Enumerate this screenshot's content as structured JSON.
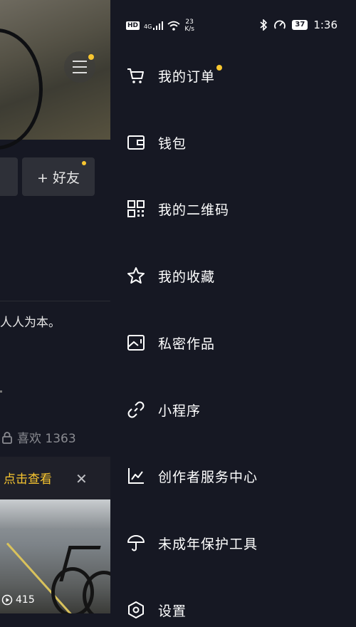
{
  "colors": {
    "background": "#161823",
    "accent_dot": "#f8c630",
    "notice_text": "#f8c630"
  },
  "status_bar": {
    "hd": "HD",
    "network": "4G",
    "speed_value": "23",
    "speed_unit": "K/s",
    "battery": "37",
    "time": "1:36",
    "icons": [
      "bluetooth-icon",
      "data-saver-icon"
    ]
  },
  "profile": {
    "add_friend_label": "+ 好友",
    "bio_fragment": "人人为本。",
    "likes_label": "喜欢 1363",
    "notice_text": "点击查看",
    "notice_close": "✕",
    "video_views": "415"
  },
  "drawer": {
    "items": [
      {
        "id": "orders",
        "label": "我的订单",
        "icon": "cart-icon",
        "badge": true
      },
      {
        "id": "wallet",
        "label": "钱包",
        "icon": "wallet-icon",
        "badge": false
      },
      {
        "id": "qrcode",
        "label": "我的二维码",
        "icon": "qr-code-icon",
        "badge": false
      },
      {
        "id": "favorites",
        "label": "我的收藏",
        "icon": "star-icon",
        "badge": false
      },
      {
        "id": "private",
        "label": "私密作品",
        "icon": "private-image-icon",
        "badge": false
      },
      {
        "id": "mini",
        "label": "小程序",
        "icon": "link-icon",
        "badge": false
      },
      {
        "id": "creator",
        "label": "创作者服务中心",
        "icon": "chart-icon",
        "badge": false
      },
      {
        "id": "minor",
        "label": "未成年保护工具",
        "icon": "umbrella-icon",
        "badge": false
      },
      {
        "id": "settings",
        "label": "设置",
        "icon": "hexagon-settings-icon",
        "badge": false
      }
    ]
  }
}
